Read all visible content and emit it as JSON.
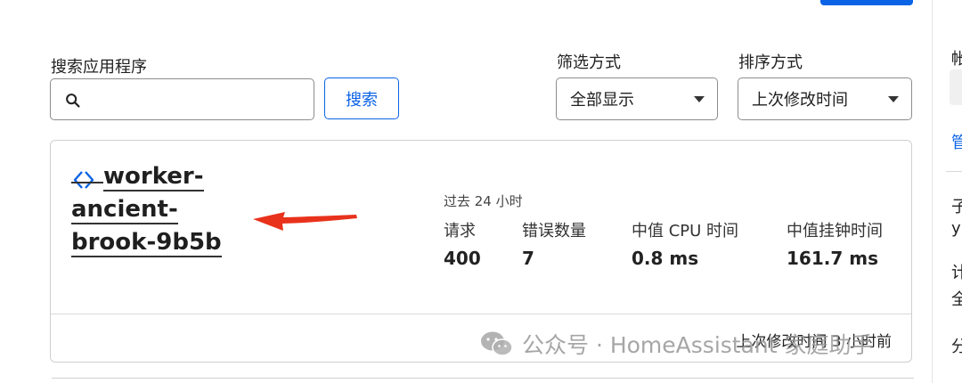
{
  "search": {
    "label": "搜索应用程序",
    "input_value": "",
    "placeholder": "",
    "button_label": "搜索"
  },
  "filter": {
    "label": "筛选方式",
    "selected": "全部显示"
  },
  "sort": {
    "label": "排序方式",
    "selected": "上次修改时间"
  },
  "worker": {
    "name_line1": "worker-ancient-",
    "name_line2": "brook-9b5b",
    "period": "过去 24 小时",
    "metrics": [
      {
        "label": "请求",
        "value": "400"
      },
      {
        "label": "错误数量",
        "value": "7"
      },
      {
        "label": "中值 CPU 时间",
        "value": "0.8 ms"
      },
      {
        "label": "中值挂钟时间",
        "value": "161.7 ms"
      }
    ],
    "last_modified": "上次修改时间 3 小时前"
  },
  "watermark": "公众号 · HomeAssistant 家庭助手",
  "right_panel": {
    "items": [
      "帐",
      "管",
      "子",
      "y",
      "计",
      "全",
      "分"
    ]
  },
  "colors": {
    "accent": "#0b63e5",
    "arrow": "#e8321c"
  }
}
